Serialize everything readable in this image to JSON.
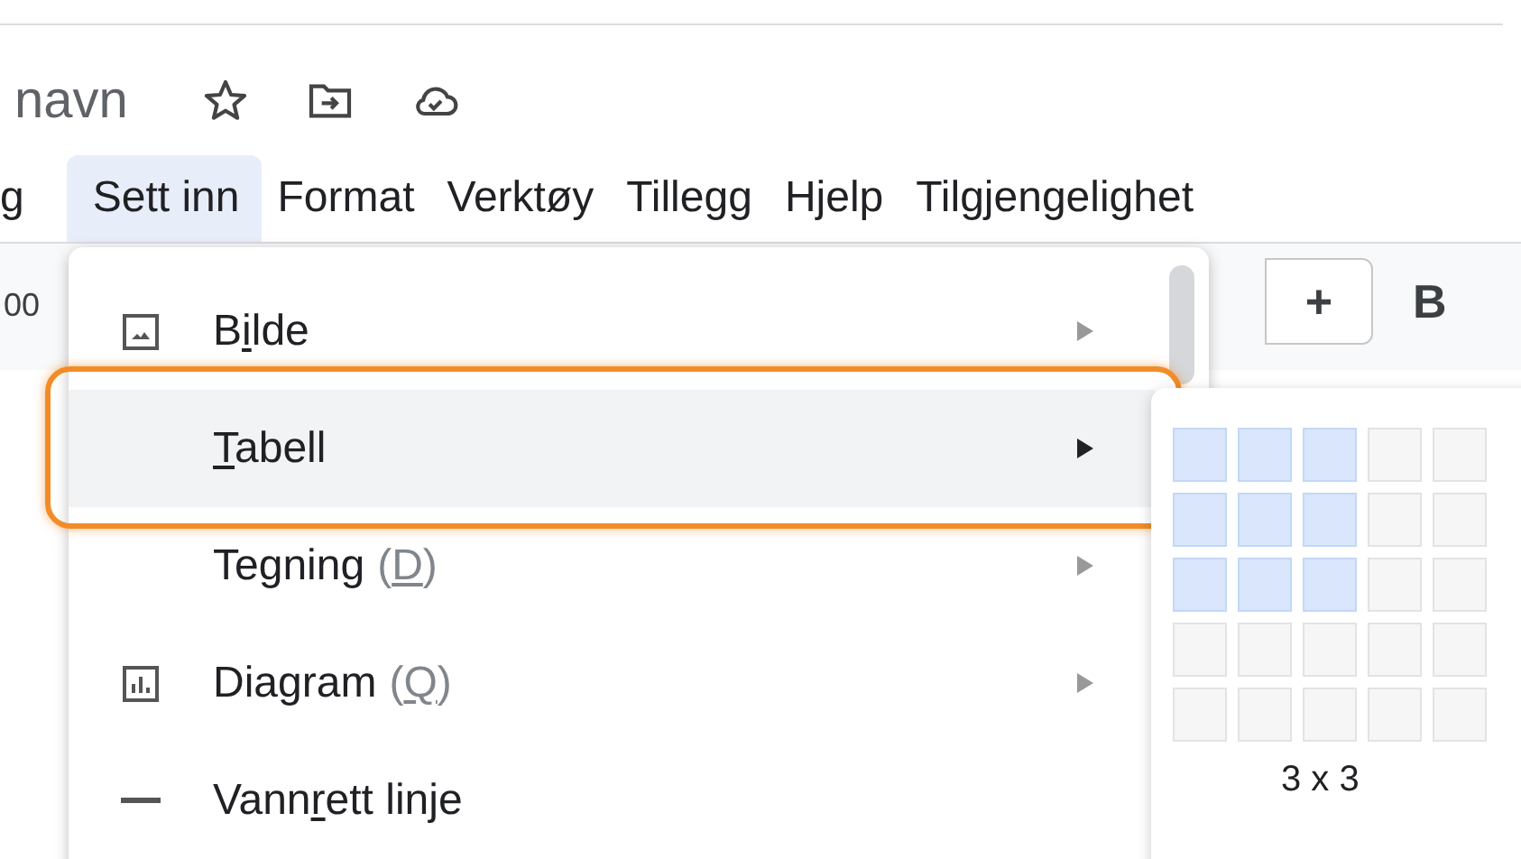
{
  "document": {
    "title": "navn"
  },
  "menu_bar": [
    {
      "label": "g",
      "selected": false
    },
    {
      "label": "Sett inn",
      "selected": true
    },
    {
      "label": "Format",
      "selected": false
    },
    {
      "label": "Verktøy",
      "selected": false
    },
    {
      "label": "Tillegg",
      "selected": false
    },
    {
      "label": "Hjelp",
      "selected": false
    },
    {
      "label": "Tilgjengelighet",
      "selected": false
    }
  ],
  "toolbar": {
    "zoom": "00",
    "plus": "+",
    "bold": "B"
  },
  "insert_menu": [
    {
      "kind": "image",
      "label": {
        "before": "B",
        "key": "i",
        "after": "lde"
      },
      "selected": false,
      "submenu": true
    },
    {
      "kind": "none",
      "label": {
        "key": "T",
        "after": "abell"
      },
      "selected": true,
      "submenu": true
    },
    {
      "kind": "none",
      "label": {
        "before": "Tegning"
      },
      "hint": {
        "before": "(",
        "key": "D",
        "after": ")"
      },
      "selected": false,
      "submenu": true
    },
    {
      "kind": "chart",
      "label": {
        "before": "Diagram"
      },
      "hint": {
        "before": "(",
        "key": "Q",
        "after": ")"
      },
      "selected": false,
      "submenu": true
    },
    {
      "kind": "line",
      "label": {
        "before": "Vann",
        "key": "r",
        "after": "ett linje"
      },
      "selected": false,
      "submenu": false
    }
  ],
  "table_picker": {
    "grid": [
      [
        {
          "selected": true
        },
        {
          "selected": true
        },
        {
          "selected": true
        },
        {
          "selected": false
        },
        {
          "selected": false
        }
      ],
      [
        {
          "selected": true
        },
        {
          "selected": true
        },
        {
          "selected": true
        },
        {
          "selected": false
        },
        {
          "selected": false
        }
      ],
      [
        {
          "selected": true
        },
        {
          "selected": true
        },
        {
          "selected": true
        },
        {
          "selected": false
        },
        {
          "selected": false
        }
      ],
      [
        {
          "selected": false
        },
        {
          "selected": false
        },
        {
          "selected": false
        },
        {
          "selected": false
        },
        {
          "selected": false
        }
      ],
      [
        {
          "selected": false
        },
        {
          "selected": false
        },
        {
          "selected": false
        },
        {
          "selected": false
        },
        {
          "selected": false
        }
      ]
    ],
    "size": "3 x 3"
  }
}
